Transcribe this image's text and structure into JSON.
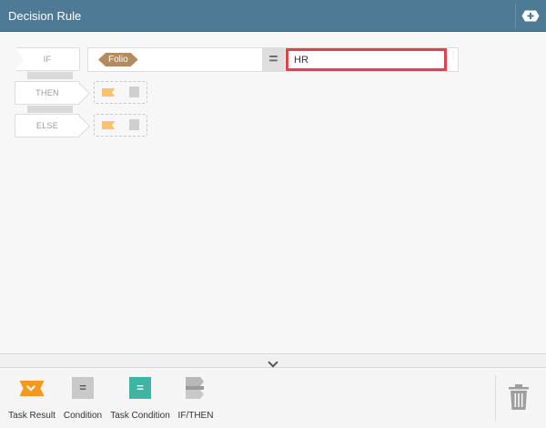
{
  "header": {
    "title": "Decision Rule",
    "add_icon": "plus-icon"
  },
  "rule": {
    "if_label": "IF",
    "then_label": "THEN",
    "else_label": "ELSE",
    "field_tag": "Folio",
    "operator": "=",
    "value": "HR"
  },
  "collapse": {
    "icon": "chevron-down-icon"
  },
  "toolbar": {
    "items": [
      {
        "label": "Task Result",
        "icon": "task-result-icon"
      },
      {
        "label": "Condition",
        "icon": "condition-icon",
        "glyph": "="
      },
      {
        "label": "Task Condition",
        "icon": "task-condition-icon",
        "glyph": "="
      },
      {
        "label": "IF/THEN",
        "icon": "if-then-icon"
      }
    ],
    "delete_icon": "trash-icon"
  },
  "colors": {
    "header_bg": "#4e7a96",
    "highlight": "#e8404a",
    "task_result": "#f29a1d",
    "task_condition": "#3fb3a4",
    "field_tag": "#b48a5f"
  }
}
